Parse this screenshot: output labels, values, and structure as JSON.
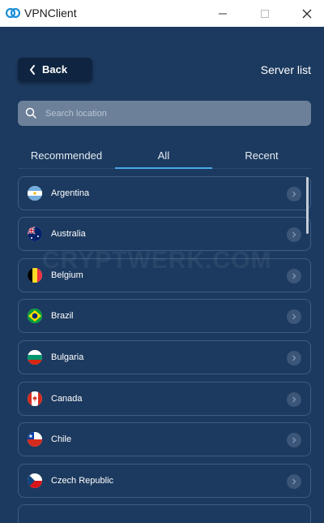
{
  "window": {
    "title": "VPNClient",
    "controls": [
      "minimize-icon",
      "maximize-icon",
      "close-icon"
    ]
  },
  "header": {
    "back_label": "Back",
    "title": "Server list"
  },
  "search": {
    "placeholder": "Search location",
    "value": ""
  },
  "tabs": [
    {
      "label": "Recommended",
      "active": false
    },
    {
      "label": "All",
      "active": true
    },
    {
      "label": "Recent",
      "active": false
    }
  ],
  "watermark": "CRYPTWERK.COM",
  "countries": [
    {
      "name": "Argentina",
      "flag": "flag-argentina"
    },
    {
      "name": "Australia",
      "flag": "flag-australia"
    },
    {
      "name": "Belgium",
      "flag": "flag-belgium"
    },
    {
      "name": "Brazil",
      "flag": "flag-brazil"
    },
    {
      "name": "Bulgaria",
      "flag": "flag-bulgaria"
    },
    {
      "name": "Canada",
      "flag": "flag-canada"
    },
    {
      "name": "Chile",
      "flag": "flag-chile"
    },
    {
      "name": "Czech Republic",
      "flag": "flag-czech-republic"
    }
  ],
  "colors": {
    "background": "#1c3a5f",
    "accent": "#4aa7e8",
    "row_border": "#3c5c82"
  }
}
